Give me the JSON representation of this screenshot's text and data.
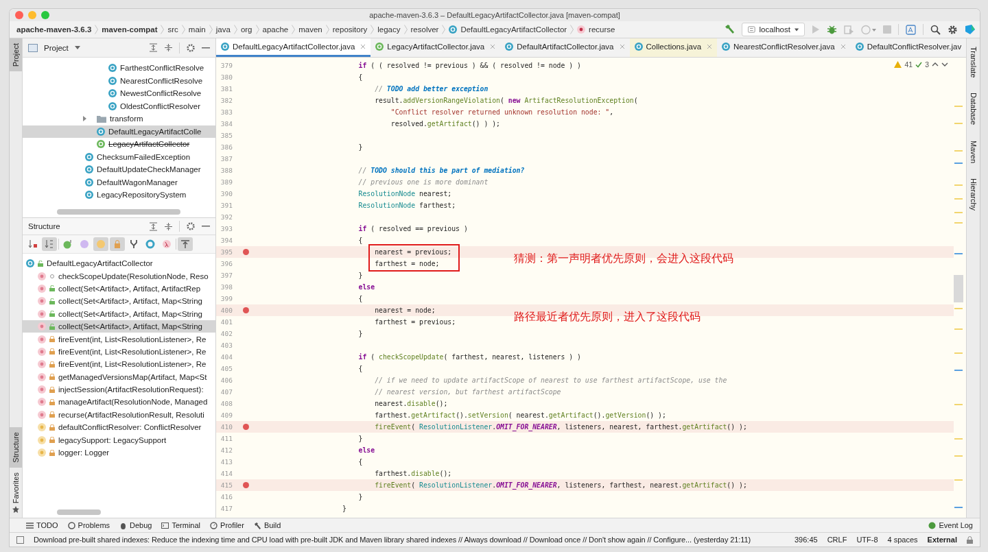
{
  "window": {
    "title": "apache-maven-3.6.3 – DefaultLegacyArtifactCollector.java [maven-compat]"
  },
  "breadcrumbs": [
    {
      "label": "apache-maven-3.6.3",
      "kind": "project"
    },
    {
      "label": "maven-compat",
      "kind": "module"
    },
    {
      "label": "src",
      "kind": "dir"
    },
    {
      "label": "main",
      "kind": "dir"
    },
    {
      "label": "java",
      "kind": "dir"
    },
    {
      "label": "org",
      "kind": "dir"
    },
    {
      "label": "apache",
      "kind": "dir"
    },
    {
      "label": "maven",
      "kind": "dir"
    },
    {
      "label": "repository",
      "kind": "dir"
    },
    {
      "label": "legacy",
      "kind": "dir"
    },
    {
      "label": "resolver",
      "kind": "dir"
    },
    {
      "label": "DefaultLegacyArtifactCollector",
      "kind": "class"
    },
    {
      "label": "recurse",
      "kind": "method"
    }
  ],
  "run_config": {
    "label": "localhost"
  },
  "left_strip": [
    {
      "label": "Project",
      "selected": true
    },
    {
      "label": "Structure",
      "selected": true
    },
    {
      "label": "Favorites",
      "selected": false
    }
  ],
  "right_strip": [
    {
      "label": "Translate"
    },
    {
      "label": "Database"
    },
    {
      "label": "Maven"
    },
    {
      "label": "Hierarchy"
    }
  ],
  "project_panel": {
    "title": "Project",
    "tree": [
      {
        "children": [
          {
            "children": [
              {
                "children": [
                  {
                    "label": "FarthestConflictResolve",
                    "kind": "class",
                    "selected": false,
                    "deprecated": false
                  },
                  {
                    "label": "NearestConflictResolve",
                    "kind": "class",
                    "selected": false,
                    "deprecated": false
                  },
                  {
                    "label": "NewestConflictResolve",
                    "kind": "class",
                    "selected": false,
                    "deprecated": false
                  },
                  {
                    "label": "OldestConflictResolver",
                    "kind": "class",
                    "selected": false,
                    "deprecated": false
                  }
                ]
              },
              {
                "label": "transform",
                "kind": "folder",
                "selected": false,
                "deprecated": false,
                "expanded": false
              },
              {
                "label": "DefaultLegacyArtifactColle",
                "kind": "class",
                "selected": true,
                "deprecated": false
              },
              {
                "label": "LegacyArtifactCollector",
                "kind": "interface",
                "selected": false,
                "deprecated": true
              }
            ]
          },
          {
            "label": "ChecksumFailedException",
            "kind": "class",
            "selected": false,
            "deprecated": false
          },
          {
            "label": "DefaultUpdateCheckManager",
            "kind": "class",
            "selected": false,
            "deprecated": false
          },
          {
            "label": "DefaultWagonManager",
            "kind": "class",
            "selected": false,
            "deprecated": false
          },
          {
            "label": "LegacyRepositorySystem",
            "kind": "class",
            "selected": false,
            "deprecated": false
          }
        ]
      }
    ]
  },
  "structure_panel": {
    "title": "Structure",
    "toolbar": [
      {
        "kind": "visibility",
        "selected": false
      },
      {
        "kind": "alpha",
        "selected": true
      },
      {
        "kind": "inherited",
        "selected": false
      },
      {
        "kind": "properties",
        "selected": false
      },
      {
        "kind": "fields",
        "selected": true
      },
      {
        "kind": "private",
        "selected": true
      },
      {
        "kind": "fork",
        "selected": false
      },
      {
        "kind": "anonymous",
        "selected": false
      },
      {
        "kind": "lambda",
        "selected": false
      },
      {
        "kind": "autoscroll",
        "selected": true
      }
    ],
    "root": {
      "label": "DefaultLegacyArtifactCollector",
      "kind": "class",
      "public": true,
      "private": false,
      "selected": false
    },
    "members": [
      {
        "label": "checkScopeUpdate(ResolutionNode, Reso",
        "kind": "method",
        "public": false,
        "private": false,
        "selected": false
      },
      {
        "label": "collect(Set<Artifact>, Artifact, ArtifactRep",
        "kind": "method",
        "public": true,
        "private": false,
        "selected": false
      },
      {
        "label": "collect(Set<Artifact>, Artifact, Map<String",
        "kind": "method",
        "public": true,
        "private": false,
        "selected": false
      },
      {
        "label": "collect(Set<Artifact>, Artifact, Map<String",
        "kind": "method",
        "public": true,
        "private": false,
        "selected": false
      },
      {
        "label": "collect(Set<Artifact>, Artifact, Map<String",
        "kind": "method",
        "public": true,
        "private": false,
        "selected": true
      },
      {
        "label": "fireEvent(int, List<ResolutionListener>, Re",
        "kind": "method",
        "public": false,
        "private": true,
        "selected": false
      },
      {
        "label": "fireEvent(int, List<ResolutionListener>, Re",
        "kind": "method",
        "public": false,
        "private": true,
        "selected": false
      },
      {
        "label": "fireEvent(int, List<ResolutionListener>, Re",
        "kind": "method",
        "public": false,
        "private": true,
        "selected": false
      },
      {
        "label": "getManagedVersionsMap(Artifact, Map<St",
        "kind": "method",
        "public": false,
        "private": true,
        "selected": false
      },
      {
        "label": "injectSession(ArtifactResolutionRequest):",
        "kind": "method",
        "public": false,
        "private": true,
        "selected": false
      },
      {
        "label": "manageArtifact(ResolutionNode, Managed",
        "kind": "method",
        "public": false,
        "private": true,
        "selected": false
      },
      {
        "label": "recurse(ArtifactResolutionResult, Resoluti",
        "kind": "method",
        "public": false,
        "private": true,
        "selected": false
      },
      {
        "label": "defaultConflictResolver: ConflictResolver",
        "kind": "field",
        "public": false,
        "private": true,
        "selected": false
      },
      {
        "label": "legacySupport: LegacySupport",
        "kind": "field",
        "public": false,
        "private": true,
        "selected": false
      },
      {
        "label": "logger: Logger",
        "kind": "field",
        "public": false,
        "private": true,
        "selected": false
      }
    ]
  },
  "editor_tabs": [
    {
      "label": "DefaultLegacyArtifactCollector.java",
      "kind": "class",
      "selected": true,
      "closable": true
    },
    {
      "label": "LegacyArtifactCollector.java",
      "kind": "interface",
      "selected": false,
      "closable": true
    },
    {
      "label": "DefaultArtifactCollector.java",
      "kind": "class",
      "selected": false,
      "closable": true
    },
    {
      "label": "Collections.java",
      "kind": "library",
      "selected": false,
      "closable": true
    },
    {
      "label": "NearestConflictResolver.java",
      "kind": "class",
      "selected": false,
      "closable": true
    },
    {
      "label": "DefaultConflictResolver.jav",
      "kind": "class",
      "selected": false,
      "closable": false
    }
  ],
  "inspections": {
    "warnings": "41",
    "typos": "3"
  },
  "code_lines": [
    {
      "number": "379",
      "kind": "code",
      "breakpoint": false,
      "boxed": false,
      "text": "                        **if** ( ( resolved != previous ) && ( resolved != node ) )"
    },
    {
      "number": "380",
      "kind": "code",
      "breakpoint": false,
      "boxed": false,
      "text": "                        {"
    },
    {
      "number": "381",
      "kind": "comment",
      "breakpoint": false,
      "boxed": false,
      "text": "                            // **TODO add better exception**"
    },
    {
      "number": "382",
      "kind": "code",
      "breakpoint": false,
      "boxed": false,
      "text": "                            result.addVersionRangeViolation( **new** ArtifactResolutionException("
    },
    {
      "number": "383",
      "kind": "code",
      "breakpoint": false,
      "boxed": false,
      "text": "                                \"Conflict resolver returned unknown resolution node: \","
    },
    {
      "number": "384",
      "kind": "code",
      "breakpoint": false,
      "boxed": false,
      "text": "                                resolved.getArtifact() ) );"
    },
    {
      "number": "385",
      "breakpoint": false,
      "boxed": false
    },
    {
      "number": "386",
      "kind": "code",
      "breakpoint": false,
      "boxed": false,
      "text": "                        }"
    },
    {
      "number": "387",
      "breakpoint": false,
      "boxed": false
    },
    {
      "number": "388",
      "kind": "comment",
      "breakpoint": false,
      "boxed": false,
      "text": "                        // **TODO should this be part of mediation?**"
    },
    {
      "number": "389",
      "kind": "comment",
      "breakpoint": false,
      "boxed": false,
      "text": "                        // previous one is more dominant"
    },
    {
      "number": "390",
      "kind": "code",
      "breakpoint": false,
      "boxed": false,
      "text": "                        ResolutionNode nearest;"
    },
    {
      "number": "391",
      "kind": "code",
      "breakpoint": false,
      "boxed": false,
      "text": "                        ResolutionNode farthest;"
    },
    {
      "number": "392",
      "breakpoint": false,
      "boxed": false
    },
    {
      "number": "393",
      "kind": "code",
      "breakpoint": false,
      "boxed": false,
      "text": "                        **if** ( resolved == previous )"
    },
    {
      "number": "394",
      "kind": "code",
      "breakpoint": false,
      "boxed": false,
      "text": "                        {"
    },
    {
      "number": "395",
      "kind": "code",
      "breakpoint": true,
      "boxed": true,
      "note": "猜测：第一声明者优先原则，会进入这段代码",
      "text": "                            nearest = previous;"
    },
    {
      "number": "396",
      "kind": "code",
      "breakpoint": false,
      "boxed": true,
      "text": "                            farthest = node;"
    },
    {
      "number": "397",
      "kind": "code",
      "breakpoint": false,
      "boxed": false,
      "text": "                        }"
    },
    {
      "number": "398",
      "kind": "code",
      "breakpoint": false,
      "boxed": false,
      "text": "                        **else**"
    },
    {
      "number": "399",
      "kind": "code",
      "breakpoint": false,
      "boxed": false,
      "text": "                        {"
    },
    {
      "number": "400",
      "kind": "code",
      "breakpoint": true,
      "boxed": false,
      "note": "路径最近者优先原则，进入了这段代码",
      "text": "                            nearest = node;"
    },
    {
      "number": "401",
      "kind": "code",
      "breakpoint": false,
      "boxed": false,
      "text": "                            farthest = previous;"
    },
    {
      "number": "402",
      "kind": "code",
      "breakpoint": false,
      "boxed": false,
      "text": "                        }"
    },
    {
      "number": "403",
      "breakpoint": false,
      "boxed": false
    },
    {
      "number": "404",
      "kind": "code",
      "breakpoint": false,
      "boxed": false,
      "text": "                        **if** ( checkScopeUpdate( farthest, nearest, listeners ) )"
    },
    {
      "number": "405",
      "kind": "code",
      "breakpoint": false,
      "boxed": false,
      "text": "                        {"
    },
    {
      "number": "406",
      "kind": "comment",
      "breakpoint": false,
      "boxed": false,
      "text": "                            // if we need to update artifactScope of nearest to use farthest artifactScope, use the"
    },
    {
      "number": "407",
      "kind": "comment",
      "breakpoint": false,
      "boxed": false,
      "text": "                            // nearest version, but farthest artifactScope"
    },
    {
      "number": "408",
      "kind": "code",
      "breakpoint": false,
      "boxed": false,
      "text": "                            nearest.disable();"
    },
    {
      "number": "409",
      "kind": "code",
      "breakpoint": false,
      "boxed": false,
      "text": "                            farthest.getArtifact().setVersion( nearest.getArtifact().getVersion() );"
    },
    {
      "number": "410",
      "kind": "code",
      "breakpoint": true,
      "boxed": false,
      "text": "                            fireEvent( ResolutionListener.OMIT_FOR_NEARER, listeners, nearest, farthest.getArtifact() );"
    },
    {
      "number": "411",
      "kind": "code",
      "breakpoint": false,
      "boxed": false,
      "text": "                        }"
    },
    {
      "number": "412",
      "kind": "code",
      "breakpoint": false,
      "boxed": false,
      "text": "                        **else**"
    },
    {
      "number": "413",
      "kind": "code",
      "breakpoint": false,
      "boxed": false,
      "text": "                        {"
    },
    {
      "number": "414",
      "kind": "code",
      "breakpoint": false,
      "boxed": false,
      "text": "                            farthest.disable();"
    },
    {
      "number": "415",
      "kind": "code",
      "breakpoint": true,
      "boxed": false,
      "text": "                            fireEvent( ResolutionListener.OMIT_FOR_NEARER, listeners, farthest, nearest.getArtifact() );"
    },
    {
      "number": "416",
      "kind": "code",
      "breakpoint": false,
      "boxed": false,
      "text": "                        }"
    },
    {
      "number": "417",
      "kind": "code",
      "breakpoint": false,
      "boxed": false,
      "text": "                    }"
    }
  ],
  "tool_tabs": [
    {
      "label": "TODO",
      "kind": "todo"
    },
    {
      "label": "Problems",
      "kind": "problems"
    },
    {
      "label": "Debug",
      "kind": "debug"
    },
    {
      "label": "Terminal",
      "kind": "terminal"
    },
    {
      "label": "Profiler",
      "kind": "profiler"
    },
    {
      "label": "Build",
      "kind": "build"
    }
  ],
  "event_log": {
    "label": "Event Log"
  },
  "status_bar": {
    "message": "Download pre-built shared indexes: Reduce the indexing time and CPU load with pre-built JDK and Maven library shared indexes // Always download // Download once // Don't show again // Configure... (yesterday 21:11)",
    "position": "396:45",
    "line_separator": "CRLF",
    "encoding": "UTF-8",
    "indent": "4 spaces",
    "context": "External"
  }
}
